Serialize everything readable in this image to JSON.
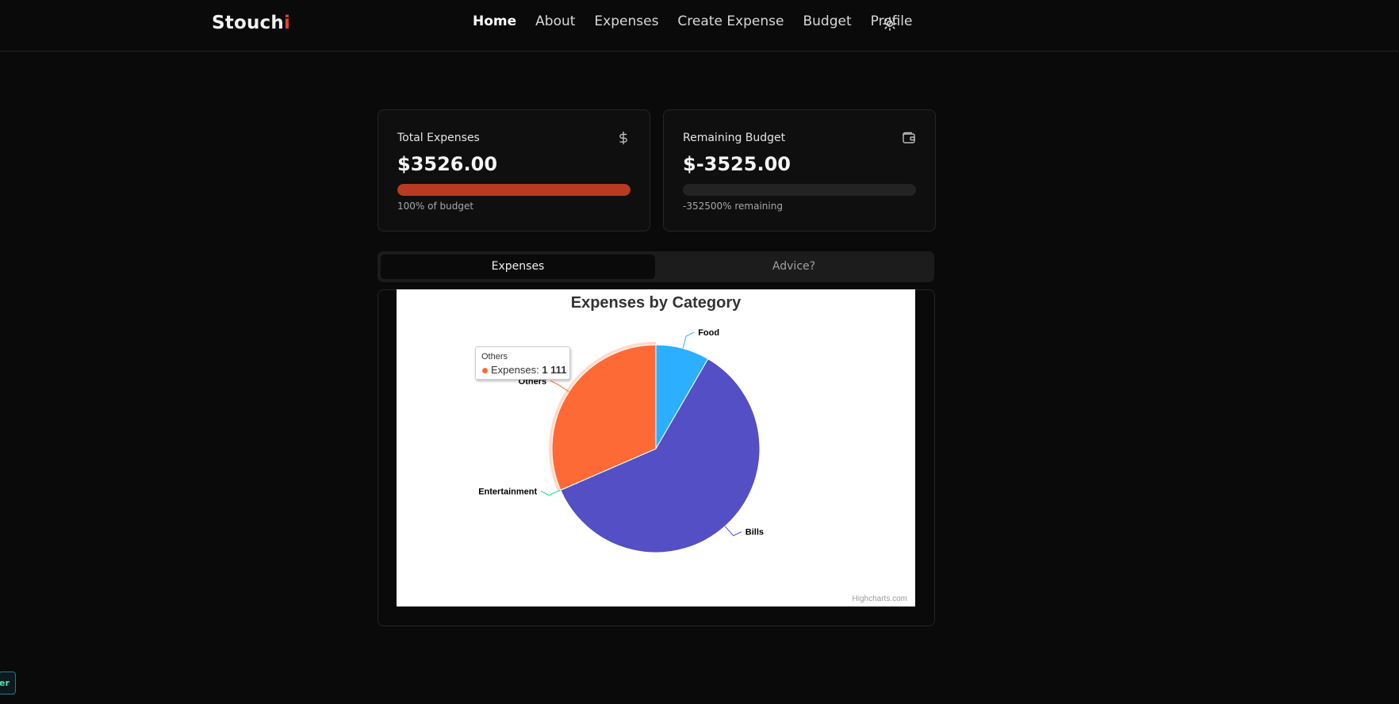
{
  "brand": {
    "name": "Stouch",
    "accent_letter": "i"
  },
  "nav": {
    "items": [
      {
        "label": "Home",
        "active": true
      },
      {
        "label": "About"
      },
      {
        "label": "Expenses"
      },
      {
        "label": "Create Expense"
      },
      {
        "label": "Budget"
      },
      {
        "label": "Profile"
      }
    ],
    "theme_icon": "sun-icon"
  },
  "cards": {
    "total": {
      "title": "Total Expenses",
      "icon": "dollar-icon",
      "value": "$3526.00",
      "progress": 1.0,
      "note": "100% of budget"
    },
    "remaining": {
      "title": "Remaining Budget",
      "icon": "wallet-icon",
      "value": "$-3525.00",
      "progress": 0.0,
      "note": "-352500% remaining"
    }
  },
  "tabs": [
    {
      "label": "Expenses",
      "active": true
    },
    {
      "label": "Advice?"
    }
  ],
  "tooltip": {
    "header": "Others",
    "series": "Expenses",
    "value": "1 111"
  },
  "credit": "Highcharts.com",
  "corner_badge": "er",
  "colors": {
    "accent": "#e0452c",
    "bar": "#b93a22",
    "food": "#2caffe",
    "bills": "#544fc5",
    "entertainment": "#00e272",
    "others": "#fe6a35"
  },
  "chart_data": {
    "type": "pie",
    "title": "Expenses by Category",
    "series": [
      {
        "name": "Expenses",
        "data": [
          {
            "name": "Food",
            "y": 295
          },
          {
            "name": "Bills",
            "y": 2119
          },
          {
            "name": "Entertainment",
            "y": 1
          },
          {
            "name": "Others",
            "y": 1111
          }
        ]
      }
    ],
    "hovered": "Others"
  }
}
